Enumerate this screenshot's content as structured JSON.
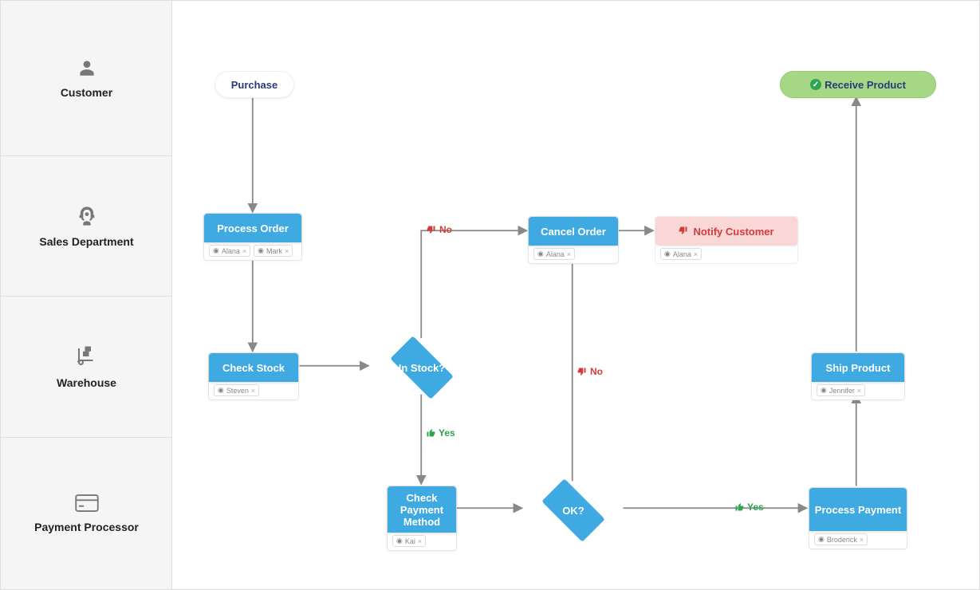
{
  "lanes": {
    "customer": "Customer",
    "sales": "Sales Department",
    "warehouse": "Warehouse",
    "payment": "Payment Processor"
  },
  "nodes": {
    "purchase": "Purchase",
    "process_order": "Process Order",
    "check_stock": "Check Stock",
    "in_stock": "In Stock?",
    "check_payment": "Check Payment Method",
    "ok": "OK?",
    "cancel_order": "Cancel Order",
    "notify_customer": "Notify Customer",
    "process_payment": "Process Payment",
    "ship_product": "Ship Product",
    "receive_product": "Receive Product"
  },
  "tags": {
    "process_order": [
      "Alana",
      "Mark"
    ],
    "check_stock": [
      "Steven"
    ],
    "check_payment": [
      "Kai"
    ],
    "cancel_order": [
      "Alana"
    ],
    "notify_customer": [
      "Alana"
    ],
    "process_payment": [
      "Broderick"
    ],
    "ship_product": [
      "Jennifer"
    ]
  },
  "edge_labels": {
    "instock_no": "No",
    "instock_yes": "Yes",
    "ok_no": "No",
    "ok_yes": "Yes"
  },
  "colors": {
    "node_blue": "#3fa9e2",
    "green_pill": "#a6d785",
    "red": "#d23c3c",
    "green": "#2fa44f",
    "navy": "#2a3b7a",
    "lane_bg": "#f5f5f5",
    "border": "#dddddd"
  },
  "diagram_type": "swimlane-flowchart"
}
